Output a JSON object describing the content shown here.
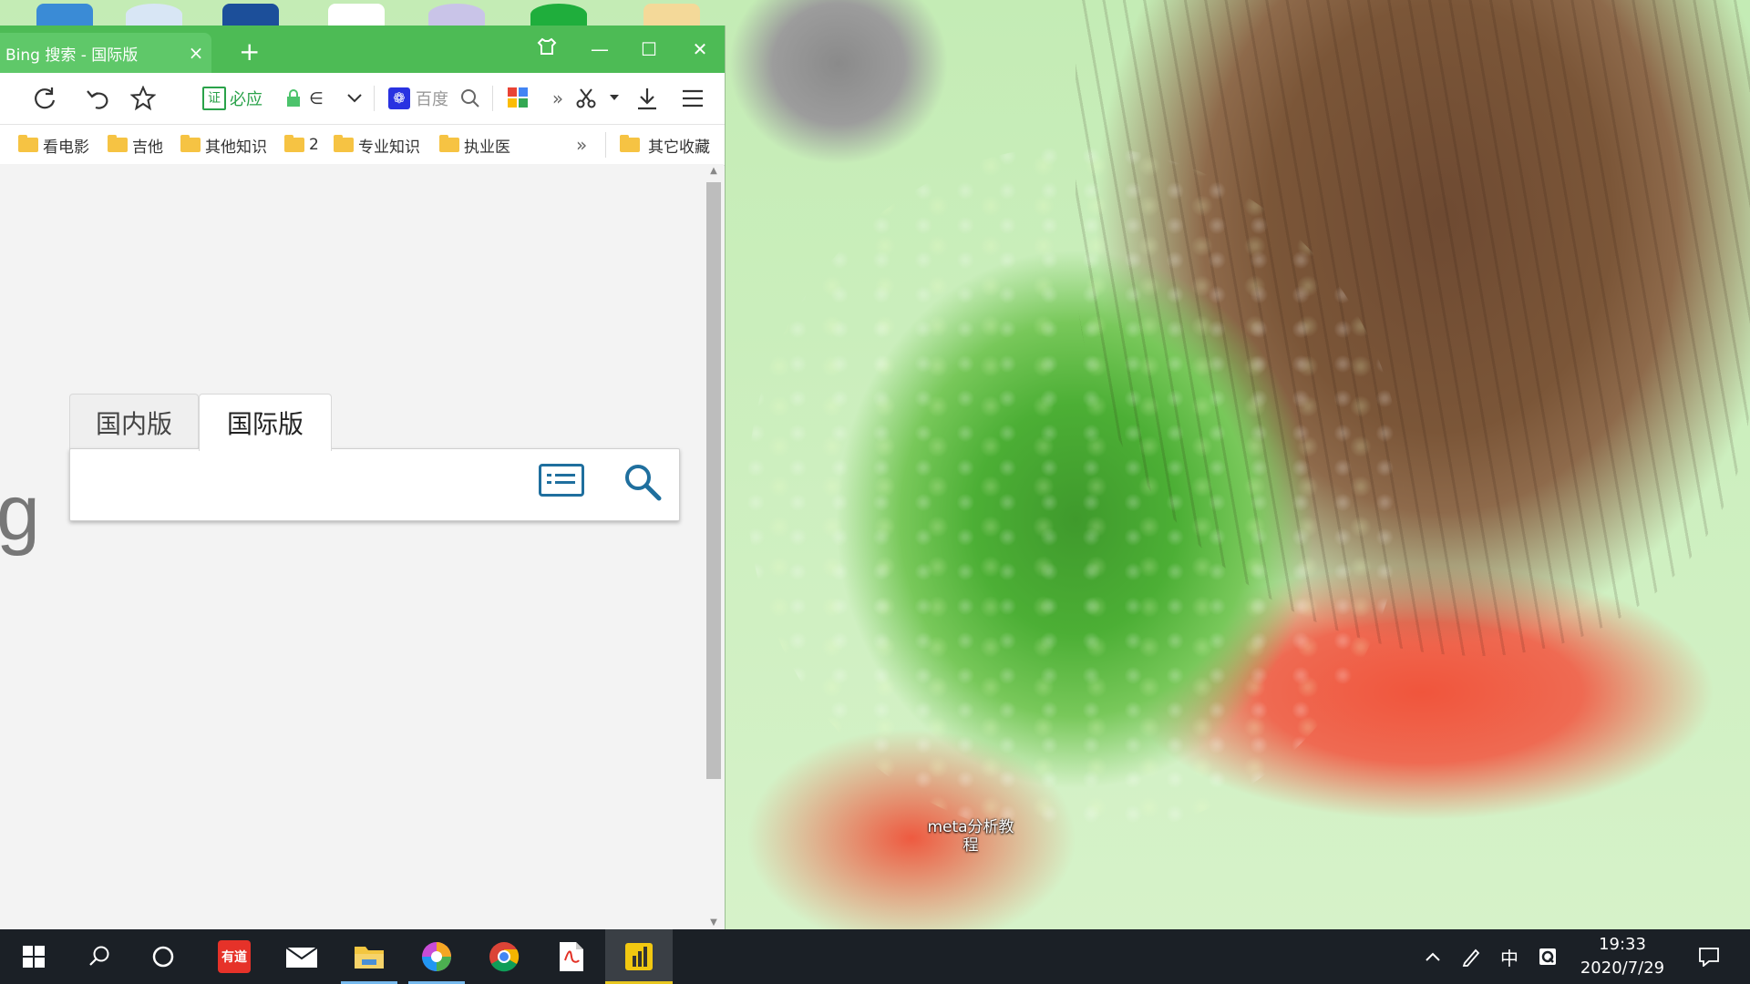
{
  "desktop": {
    "shortcut_label": "meta分析教程"
  },
  "browser": {
    "tab": {
      "title": "Bing 搜索 - 国际版",
      "close": "×"
    },
    "new_tab": "+",
    "window_controls": {
      "minimize": "—",
      "maximize": "☐",
      "close": "✕"
    },
    "toolbar": {
      "certificate_label": "必应",
      "certificate_badge": "证",
      "baidu_text": "百度",
      "more": "»"
    },
    "bookmarks": [
      {
        "label": "看电影"
      },
      {
        "label": "吉他"
      },
      {
        "label": "其他知识"
      },
      {
        "label": "2"
      },
      {
        "label": "专业知识"
      },
      {
        "label": "执业医"
      }
    ],
    "bookmarks_more": "»",
    "other_bookmarks": "其它收藏",
    "page": {
      "logo_fragment": "g",
      "tabs": [
        {
          "label": "国内版",
          "active": false
        },
        {
          "label": "国际版",
          "active": true
        }
      ],
      "search_placeholder": ""
    }
  },
  "taskbar": {
    "clock_time": "19:33",
    "clock_date": "2020/7/29",
    "ime": "中",
    "apps": [
      {
        "name": "有道",
        "color": "#e63229"
      },
      {
        "name": "mail",
        "color": "#ffffff"
      },
      {
        "name": "file-explorer",
        "color": "#f3c640"
      },
      {
        "name": "color-picker",
        "color": "#c94cd6"
      },
      {
        "name": "chrome",
        "color": "#4285f4"
      },
      {
        "name": "pdf",
        "color": "#e33025"
      },
      {
        "name": "power-bi",
        "color": "#f2c811"
      }
    ]
  },
  "colors": {
    "titlebar": "#4dbb55",
    "taskbar": "#1b2026",
    "accent_blue": "#1f6f9e"
  }
}
